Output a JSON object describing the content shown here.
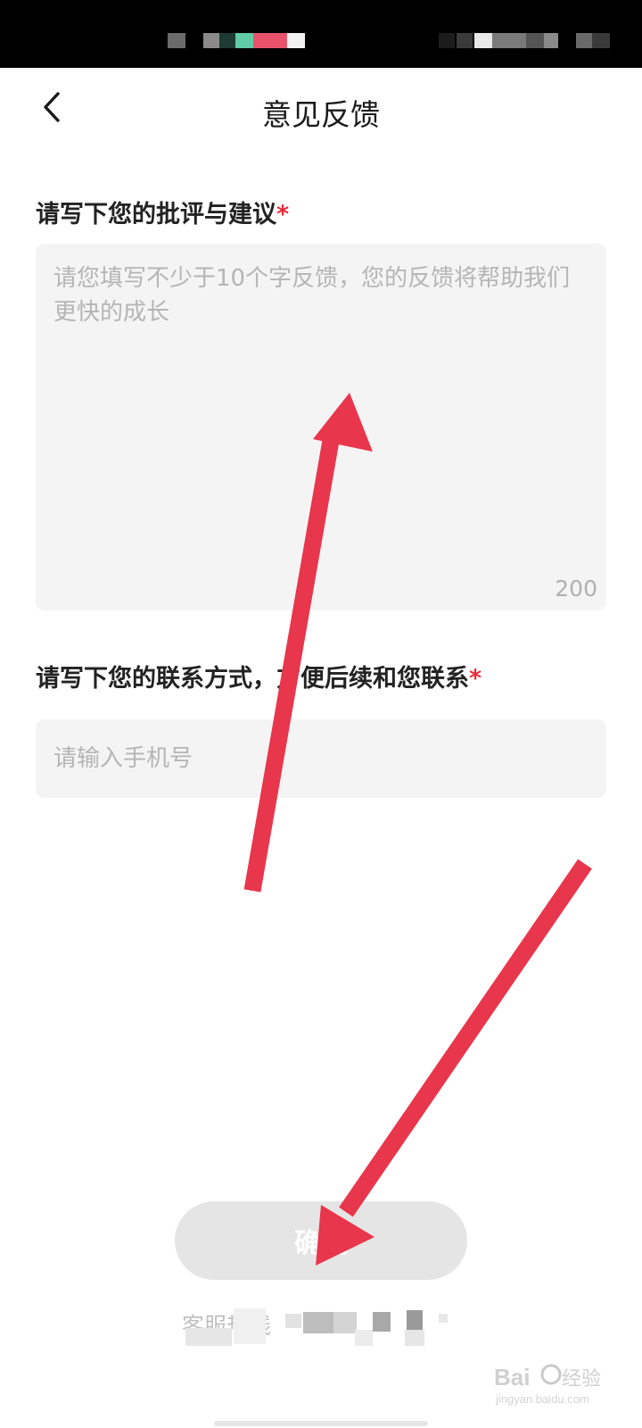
{
  "header": {
    "title": "意见反馈",
    "back_icon": "chevron-left-icon"
  },
  "feedback": {
    "label": "请写下您的批评与建议",
    "required_mark": "*",
    "placeholder": "请您填写不少于10个字反馈，您的反馈将帮助我们更快的成长",
    "max_chars": "200"
  },
  "contact": {
    "label": "请写下您的联系方式，方便后续和您联系",
    "required_mark": "*",
    "placeholder": "请输入手机号"
  },
  "footer": {
    "confirm_label": "确定",
    "hotline_label": "客服热线"
  },
  "colors": {
    "required": "#e8293a",
    "annotation_arrow": "#e8364c",
    "field_bg": "#f4f4f4",
    "button_disabled_bg": "#e5e5e5"
  }
}
